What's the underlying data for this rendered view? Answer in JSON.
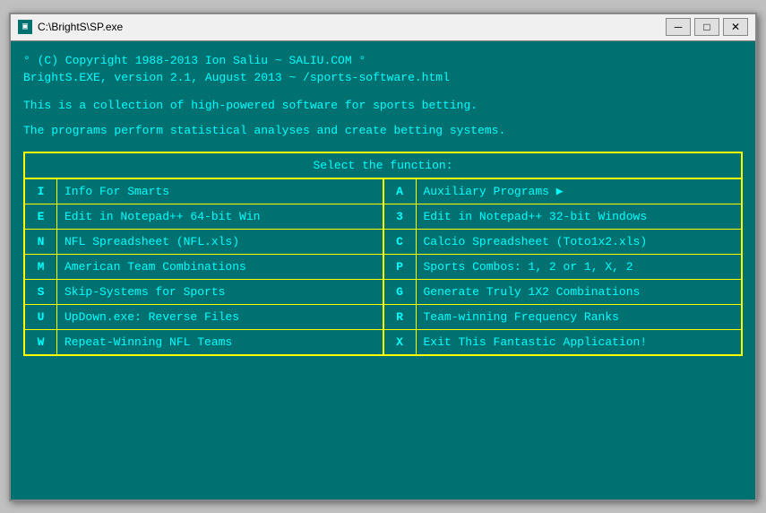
{
  "window": {
    "title": "C:\\BrightS\\SP.exe",
    "icon": "▣"
  },
  "titlebar": {
    "minimize": "─",
    "maximize": "□",
    "close": "✕"
  },
  "header": {
    "line1": "° (C) Copyright 1988-2013 Ion Saliu ~ SALIU.COM °",
    "line2": "BrightS.EXE, version 2.1, August 2013 ~ /sports-software.html",
    "line3": "",
    "line4": "This is a collection of high-powered software for sports betting.",
    "line5": "",
    "line6": "The programs perform statistical analyses and create betting systems."
  },
  "menu": {
    "header": "Select the function:",
    "rows": [
      {
        "key1": "I",
        "label1": "Info For Smarts",
        "key2": "A",
        "label2": "Auxiliary Programs ▶"
      },
      {
        "key1": "E",
        "label1": "Edit in Notepad++ 64-bit Win",
        "key2": "3",
        "label2": "Edit in Notepad++ 32-bit Windows"
      },
      {
        "key1": "N",
        "label1": "NFL Spreadsheet (NFL.xls)",
        "key2": "C",
        "label2": "Calcio Spreadsheet (Toto1x2.xls)"
      },
      {
        "key1": "M",
        "label1": "American Team Combinations",
        "key2": "P",
        "label2": "Sports Combos:  1, 2 or 1, X, 2"
      },
      {
        "key1": "S",
        "label1": "Skip-Systems for Sports",
        "key2": "G",
        "label2": "Generate Truly 1X2 Combinations"
      },
      {
        "key1": "U",
        "label1": "UpDown.exe: Reverse Files",
        "key2": "R",
        "label2": "Team-winning Frequency Ranks"
      },
      {
        "key1": "W",
        "label1": "Repeat-Winning NFL Teams",
        "key2": "X",
        "label2": "Exit This Fantastic Application!"
      }
    ]
  }
}
